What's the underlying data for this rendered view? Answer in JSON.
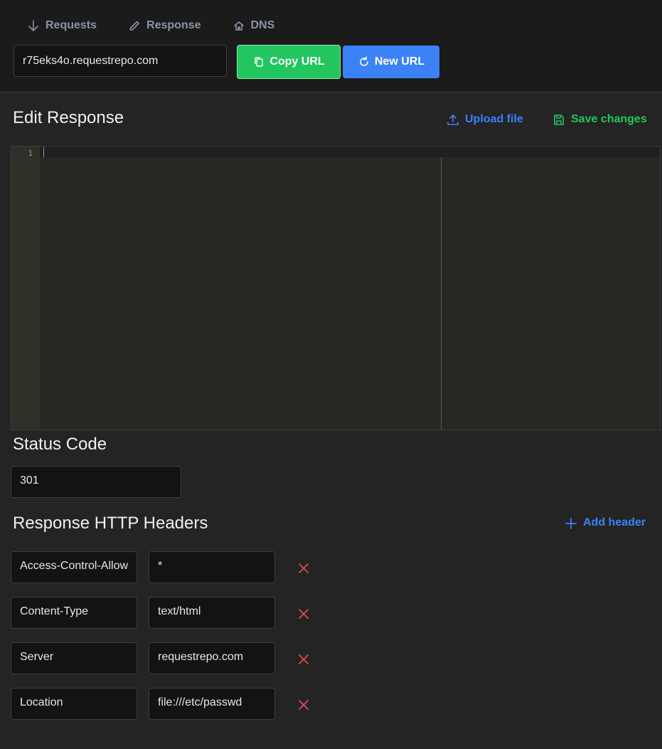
{
  "nav": {
    "tabs": [
      {
        "label": "Requests",
        "icon": "arrow-down-icon"
      },
      {
        "label": "Response",
        "icon": "pencil-icon"
      },
      {
        "label": "DNS",
        "icon": "home-icon"
      }
    ]
  },
  "url": {
    "value": "r75eks4o.requestrepo.com"
  },
  "buttons": {
    "copy_url": "Copy URL",
    "new_url": "New URL"
  },
  "edit_response": {
    "title": "Edit Response",
    "upload_label": "Upload file",
    "save_label": "Save changes",
    "editor": {
      "line_number": "1",
      "content": ""
    }
  },
  "status_code": {
    "title": "Status Code",
    "value": "301"
  },
  "headers": {
    "title": "Response HTTP Headers",
    "add_label": "Add header",
    "rows": [
      {
        "name": "Access-Control-Allow",
        "value": "*"
      },
      {
        "name": "Content-Type",
        "value": "text/html"
      },
      {
        "name": "Server",
        "value": "requestrepo.com"
      },
      {
        "name": "Location",
        "value": "file:///etc/passwd"
      }
    ]
  },
  "colors": {
    "accent_blue": "#3b82f6",
    "accent_green": "#22c55e",
    "danger_red": "#e5484d",
    "tab_gray": "#8a94a6"
  }
}
